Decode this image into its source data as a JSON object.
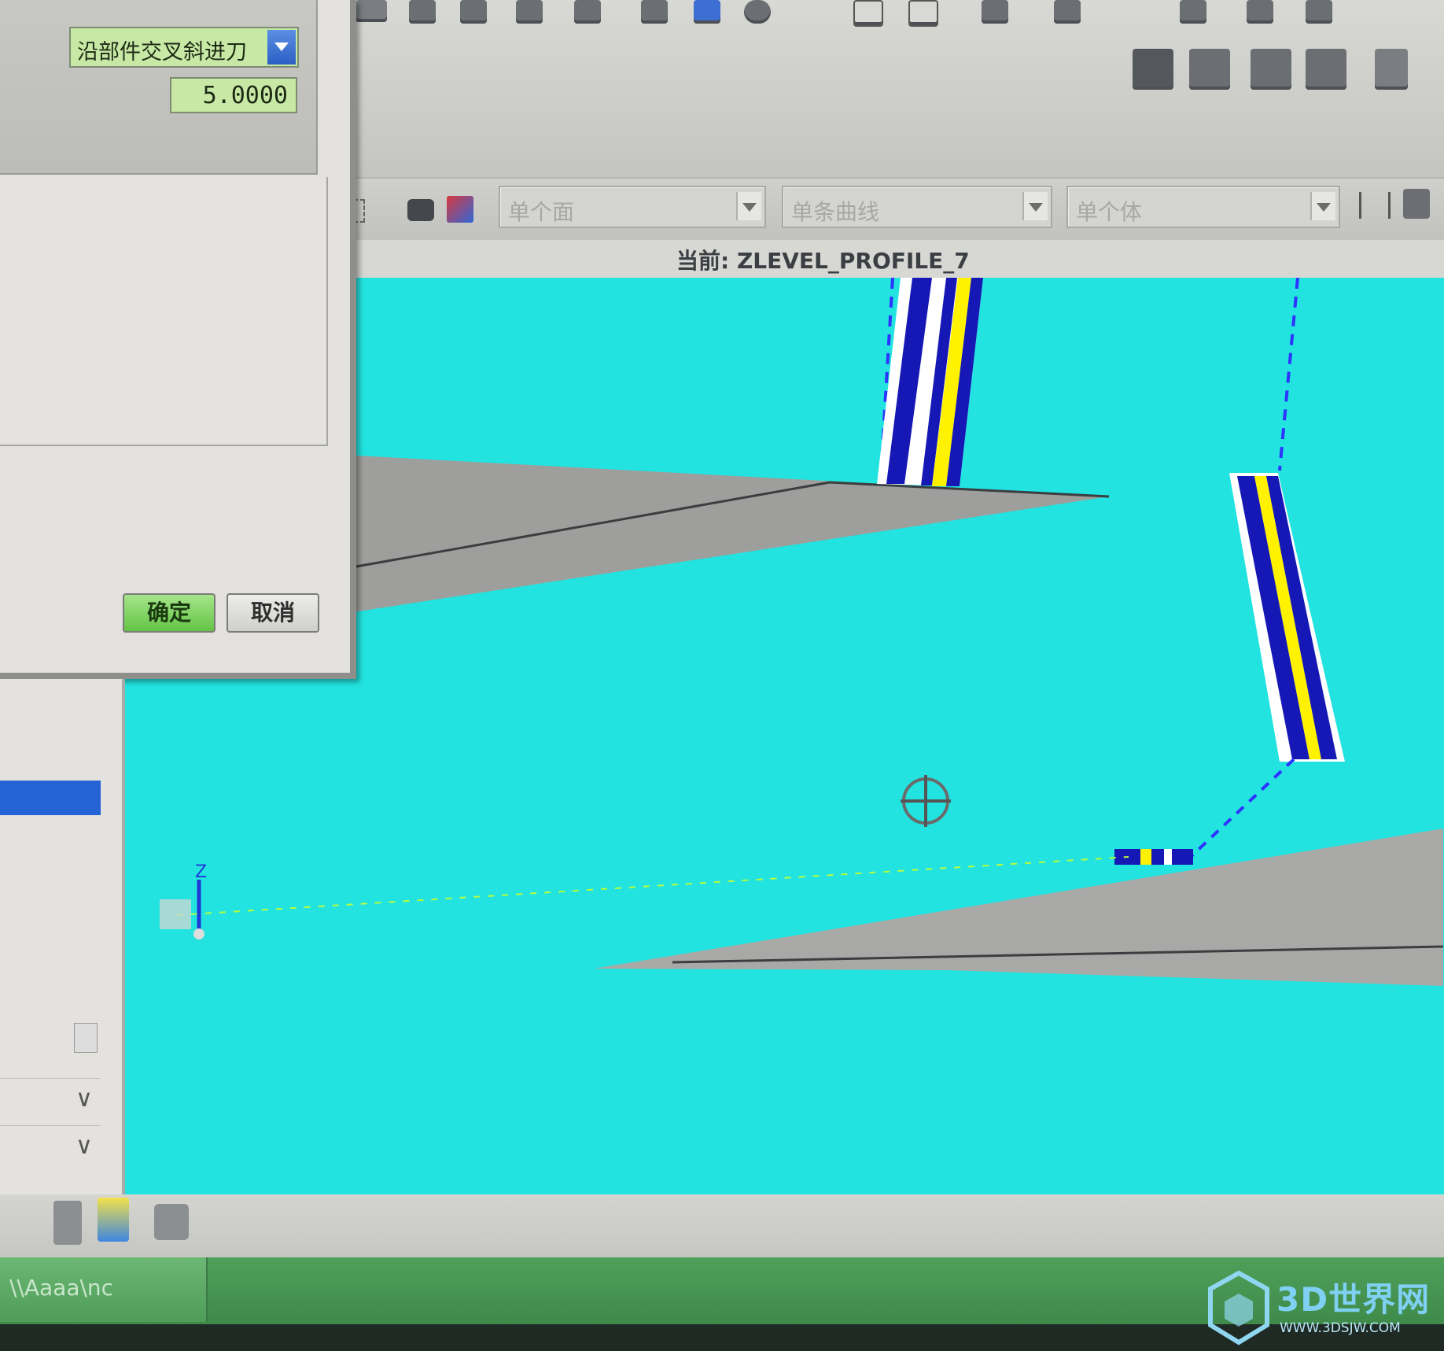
{
  "dialog": {
    "engage_type_value": "沿部件交叉斜进刀",
    "distance_value": "5.0000",
    "ok_label": "确定",
    "cancel_label": "取消"
  },
  "selection_bar": {
    "face_filter": "单个面",
    "curve_filter": "单条曲线",
    "body_filter": "单个体"
  },
  "viewport": {
    "current_label": "当前: ZLEVEL_PROFILE_7",
    "background_color": "#22e3df",
    "axis_label": "Z"
  },
  "status_bar": {
    "path": "\\\\Aaaa\\nc"
  },
  "watermark": {
    "title": "3D世界网",
    "url": "WWW.3DSJW.COM"
  }
}
